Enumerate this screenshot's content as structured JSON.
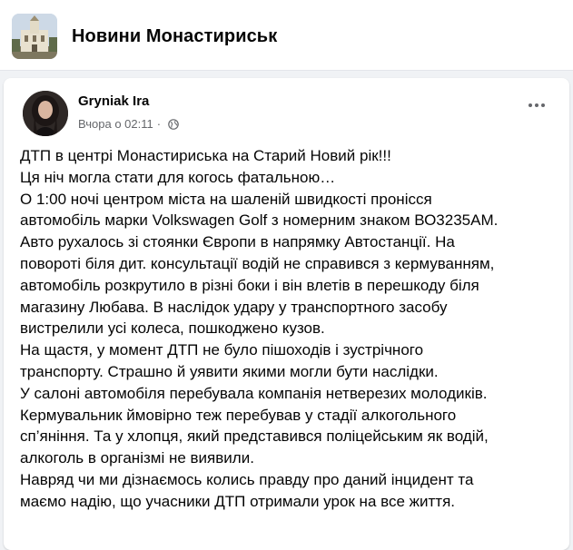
{
  "group": {
    "name": "Новини Монастириськ",
    "avatar_icon": "church-photo"
  },
  "post": {
    "author": "Gryniak Ira",
    "timestamp": "Вчора о 02:11",
    "separator": "·",
    "audience_icon": "globe-icon",
    "more_icon": "more-options-icon",
    "lines": [
      "ДТП в центрі Монастириська на Старий Новий рік!!!",
      "Ця ніч могла стати для когось фатальною…",
      "О 1:00 ночі центром міста на шаленій швидкості пронісся",
      "автомобіль марки Volkswagen Golf з номерним знаком ВО3235АМ.",
      "Авто рухалось зі стоянки Європи в напрямку Автостанції. На",
      "повороті біля дит. консультації водій не справився з кермуванням,",
      "автомобіль розкрутило в різні боки і він влетів в перешкоду біля",
      "магазину Любава. В наслідок удару у транспортного засобу",
      "вистрелили усі колеса, пошкоджено кузов.",
      "На щастя, у момент ДТП не було пішоходів і зустрічного",
      "транспорту. Страшно й уявити якими могли бути наслідки.",
      "У салоні автомобіля перебувала компанія нетверезих молодиків.",
      "Кермувальник ймовірно теж перебував у стадії алкогольного",
      "сп’яніння. Та у хлопця, який представився поліцейським як водій,",
      "алкоголь в організмі не виявили.",
      "Навряд чи ми дізнаємось колись правду про даний інцидент та",
      "маємо надію, що учасники ДТП отримали урок на все життя."
    ]
  },
  "colors": {
    "background": "#f0f2f5",
    "card": "#ffffff",
    "text": "#050505",
    "secondary_text": "#65676b"
  }
}
